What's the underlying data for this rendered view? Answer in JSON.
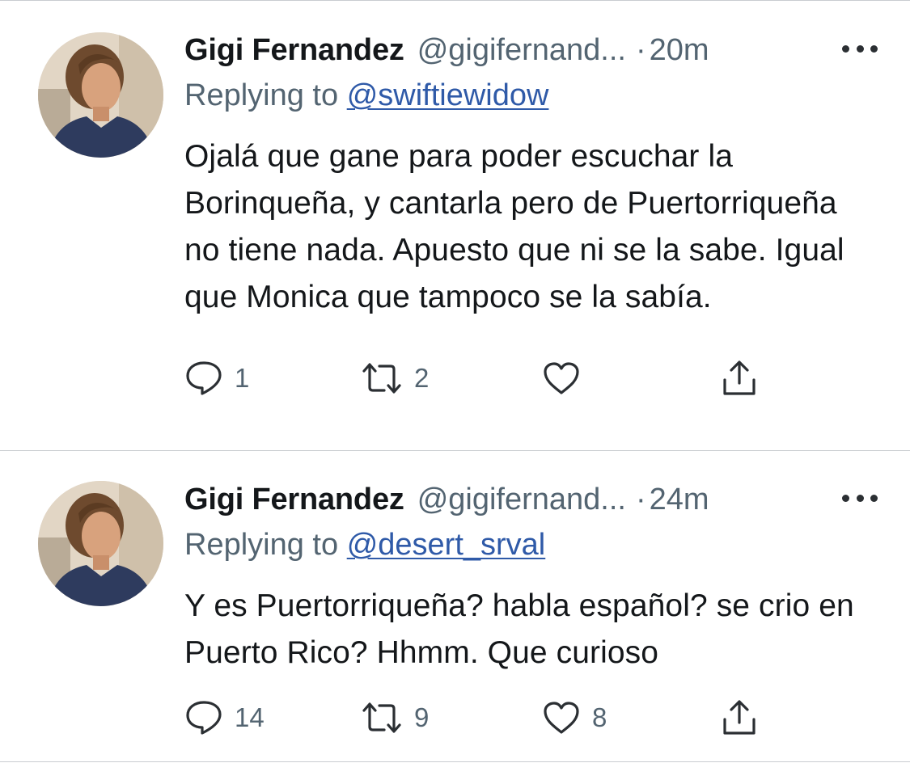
{
  "tweets": [
    {
      "author": {
        "name": "Gigi Fernandez",
        "handle": "@gigifernand...",
        "avatar": "profile-photo"
      },
      "time_prefix": "·",
      "time": "20m",
      "replying_prefix": "Replying to",
      "replying_to": "@swiftiewidow",
      "text": "Ojalá que gane para poder escuchar la Borinqueña, y cantarla pero de Puertorriqueña no tiene nada. Apuesto que ni se la sabe. Igual que Monica que tampoco se la sabía.",
      "actions": {
        "reply_count": "1",
        "retweet_count": "2",
        "like_count": "",
        "icons": [
          "reply-icon",
          "retweet-icon",
          "like-icon",
          "share-icon"
        ]
      }
    },
    {
      "author": {
        "name": "Gigi Fernandez",
        "handle": "@gigifernand...",
        "avatar": "profile-photo"
      },
      "time_prefix": "·",
      "time": "24m",
      "replying_prefix": "Replying to",
      "replying_to": "@desert_srval",
      "text": "Y es Puertorriqueña? habla español? se crio en Puerto Rico? Hhmm. Que curioso",
      "actions": {
        "reply_count": "14",
        "retweet_count": "9",
        "like_count": "8",
        "icons": [
          "reply-icon",
          "retweet-icon",
          "like-icon",
          "share-icon"
        ]
      }
    }
  ],
  "colors": {
    "text": "#14171a",
    "secondary": "#536471",
    "link": "#2f5aa8",
    "divider": "#c9ccd0",
    "background": "#ffffff"
  }
}
